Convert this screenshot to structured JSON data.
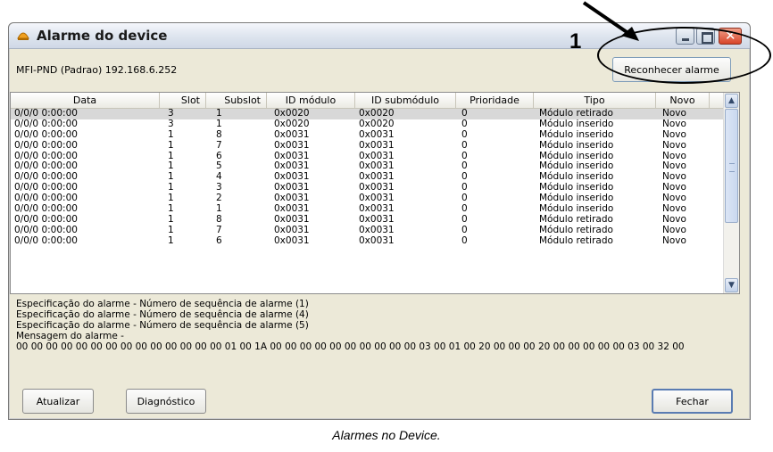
{
  "window": {
    "title": "Alarme do device",
    "device_label": "MFI-PND (Padrao)   192.168.6.252",
    "ack_button": "Reconhecer alarme"
  },
  "table": {
    "columns": [
      "Data",
      "Slot",
      "Subslot",
      "ID módulo",
      "ID submódulo",
      "Prioridade",
      "Tipo",
      "Novo"
    ],
    "rows": [
      [
        "0/0/0 0:00:00",
        "3",
        "1",
        "0x0020",
        "0x0020",
        "0",
        "Módulo retirado",
        "Novo"
      ],
      [
        "0/0/0 0:00:00",
        "3",
        "1",
        "0x0020",
        "0x0020",
        "0",
        "Módulo inserido",
        "Novo"
      ],
      [
        "0/0/0 0:00:00",
        "1",
        "8",
        "0x0031",
        "0x0031",
        "0",
        "Módulo inserido",
        "Novo"
      ],
      [
        "0/0/0 0:00:00",
        "1",
        "7",
        "0x0031",
        "0x0031",
        "0",
        "Módulo inserido",
        "Novo"
      ],
      [
        "0/0/0 0:00:00",
        "1",
        "6",
        "0x0031",
        "0x0031",
        "0",
        "Módulo inserido",
        "Novo"
      ],
      [
        "0/0/0 0:00:00",
        "1",
        "5",
        "0x0031",
        "0x0031",
        "0",
        "Módulo inserido",
        "Novo"
      ],
      [
        "0/0/0 0:00:00",
        "1",
        "4",
        "0x0031",
        "0x0031",
        "0",
        "Módulo inserido",
        "Novo"
      ],
      [
        "0/0/0 0:00:00",
        "1",
        "3",
        "0x0031",
        "0x0031",
        "0",
        "Módulo inserido",
        "Novo"
      ],
      [
        "0/0/0 0:00:00",
        "1",
        "2",
        "0x0031",
        "0x0031",
        "0",
        "Módulo inserido",
        "Novo"
      ],
      [
        "0/0/0 0:00:00",
        "1",
        "1",
        "0x0031",
        "0x0031",
        "0",
        "Módulo inserido",
        "Novo"
      ],
      [
        "0/0/0 0:00:00",
        "1",
        "8",
        "0x0031",
        "0x0031",
        "0",
        "Módulo retirado",
        "Novo"
      ],
      [
        "0/0/0 0:00:00",
        "1",
        "7",
        "0x0031",
        "0x0031",
        "0",
        "Módulo retirado",
        "Novo"
      ],
      [
        "0/0/0 0:00:00",
        "1",
        "6",
        "0x0031",
        "0x0031",
        "0",
        "Módulo retirado",
        "Novo"
      ]
    ],
    "selected_row": 0
  },
  "details": {
    "lines": [
      "Especificação do alarme - Número de sequência de alarme (1)",
      "Especificação do alarme - Número de sequência de alarme (4)",
      "Especificação do alarme - Número de sequência de alarme (5)",
      "Mensagem do alarme -"
    ],
    "hex": "00 00 00 00 00 00 00 00 00 00 00 00 00 00 01 00 1A 00 00 00 00 00 00 00 00 00 00 03 00 01 00 20 00 00 00 20 00 00 00 00 00 03 00 32 00"
  },
  "buttons": {
    "atualizar": "Atualizar",
    "diagnostico": "Diagnóstico",
    "fechar": "Fechar"
  },
  "annotation": {
    "marker": "1"
  },
  "caption": "Alarmes no Device.",
  "icons": {
    "title": "alarm-device-icon",
    "min": "minimize-icon",
    "max": "maximize-icon",
    "close": "close-icon"
  },
  "colors": {
    "window_bg": "#ece9d8",
    "close_button": "#d8452a",
    "selected_row": "#d8d8d8"
  }
}
